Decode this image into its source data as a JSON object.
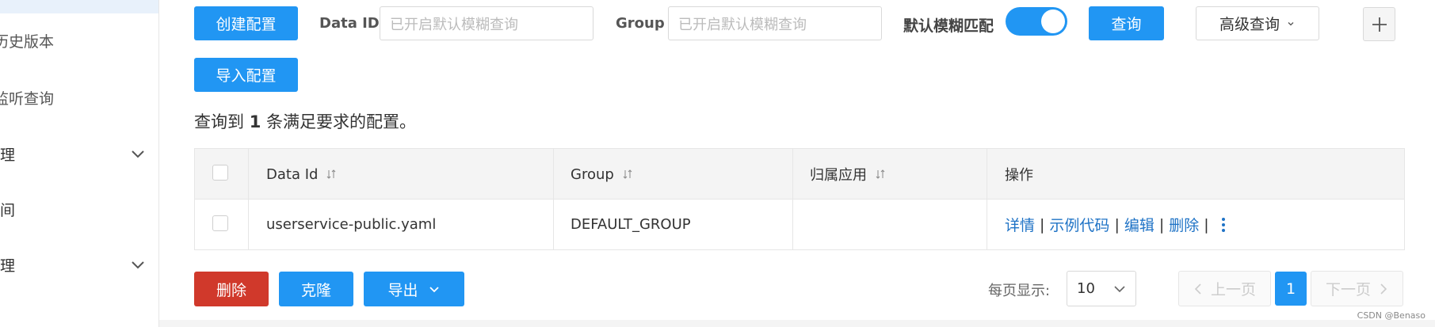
{
  "sidebar": {
    "items": [
      {
        "label": "历史版本",
        "has_chevron": false
      },
      {
        "label": "监听查询",
        "has_chevron": false
      },
      {
        "label": "管理",
        "has_chevron": true
      },
      {
        "label": "空间",
        "has_chevron": false
      },
      {
        "label": "管理",
        "has_chevron": true
      }
    ]
  },
  "toolbar": {
    "create_label": "创建配置",
    "import_label": "导入配置",
    "dataid_label": "Data ID",
    "dataid_placeholder": "已开启默认模糊查询",
    "group_label": "Group",
    "group_placeholder": "已开启默认模糊查询",
    "fuzzy_label": "默认模糊匹配",
    "fuzzy_enabled": true,
    "query_label": "查询",
    "advanced_label": "高级查询",
    "plus_label": "+"
  },
  "summary": {
    "prefix": "查询到",
    "count": "1",
    "suffix": "条满足要求的配置。"
  },
  "table": {
    "headers": [
      "Data Id",
      "Group",
      "归属应用",
      "操作"
    ],
    "rows": [
      {
        "data_id": "userservice-public.yaml",
        "group": "DEFAULT_GROUP",
        "app": ""
      }
    ],
    "actions": [
      "详情",
      "示例代码",
      "编辑",
      "删除"
    ],
    "sep": "|"
  },
  "bulk": {
    "delete_label": "删除",
    "clone_label": "克隆",
    "export_label": "导出"
  },
  "pagination": {
    "per_page_label": "每页显示:",
    "per_page_value": "10",
    "prev_label": "上一页",
    "current_page": "1",
    "next_label": "下一页"
  },
  "watermark": "CSDN @Benaso",
  "colors": {
    "primary": "#2196f3",
    "danger": "#d0392b",
    "link": "#1f73c6"
  }
}
